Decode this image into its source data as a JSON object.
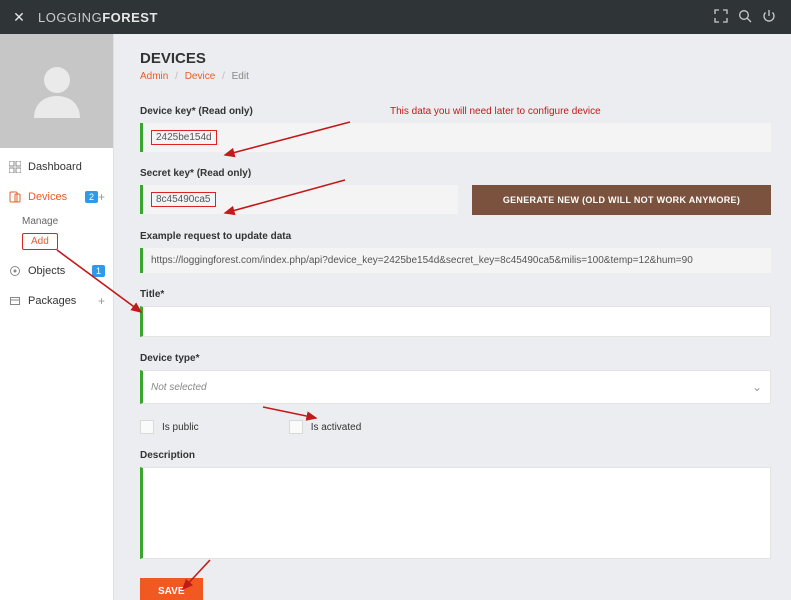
{
  "brand": {
    "light": "LOGGING",
    "bold": "FOREST"
  },
  "sidebar": {
    "items": [
      {
        "label": "Dashboard",
        "badge": "",
        "plus": ""
      },
      {
        "label": "Devices",
        "badge": "2",
        "plus": "+"
      },
      {
        "label": "Objects",
        "badge": "1",
        "plus": ""
      },
      {
        "label": "Packages",
        "badge": "",
        "plus": "+"
      }
    ],
    "sub": {
      "manage": "Manage",
      "add": "Add"
    }
  },
  "page": {
    "title": "DEVICES",
    "crumb1": "Admin",
    "crumb2": "Device",
    "crumb3": "Edit"
  },
  "form": {
    "device_key_label": "Device key* (Read only)",
    "device_key_value": "2425be154d",
    "note": "This data you will need later to configure device",
    "secret_key_label": "Secret key* (Read only)",
    "secret_key_value": "8c45490ca5",
    "generate_label": "GENERATE NEW (OLD WILL NOT WORK ANYMORE)",
    "example_label": "Example request to update data",
    "example_value": "https://loggingforest.com/index.php/api?device_key=2425be154d&secret_key=8c45490ca5&milis=100&temp=12&hum=90",
    "title_label": "Title*",
    "title_value": "",
    "device_type_label": "Device type*",
    "device_type_value": "Not selected",
    "is_public": "Is public",
    "is_activated": "Is activated",
    "description_label": "Description",
    "description_value": "",
    "save_label": "SAVE"
  }
}
